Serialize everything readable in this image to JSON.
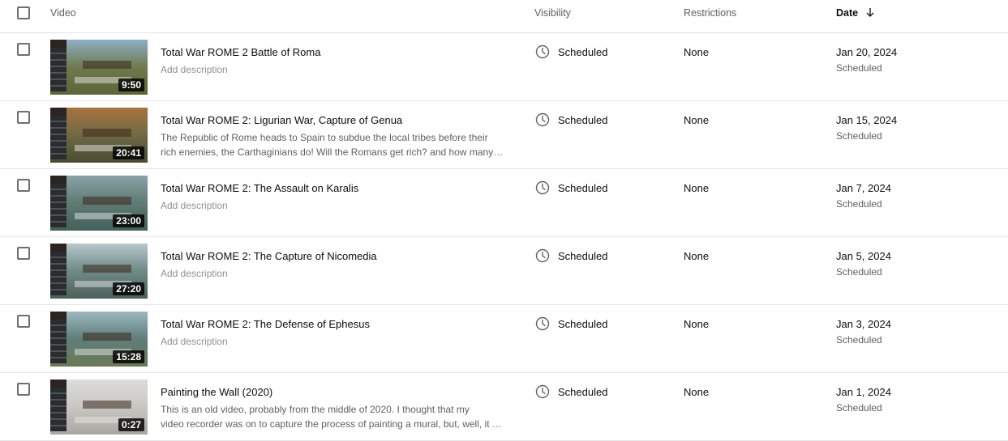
{
  "header": {
    "video": "Video",
    "visibility": "Visibility",
    "restrictions": "Restrictions",
    "date": "Date",
    "sort_icon": "arrow-down-icon"
  },
  "rows": [
    {
      "title": "Total War ROME 2 Battle of Roma",
      "desc_lines": [
        "Add description"
      ],
      "placeholder": true,
      "duration": "9:50",
      "visibility": "Scheduled",
      "restrictions": "None",
      "date": "Jan 20, 2024",
      "date_status": "Scheduled",
      "thumb_colors": [
        "#8fb0c4",
        "#6e7a4e",
        "#5a6638"
      ]
    },
    {
      "title": "Total War ROME 2: Ligurian War, Capture of Genua",
      "desc_lines": [
        "The Republic of Rome heads to Spain to subdue the local tribes before their",
        "rich enemies, the Carthaginians do! Will the Romans get rich? and how many dead?"
      ],
      "placeholder": false,
      "duration": "20:41",
      "visibility": "Scheduled",
      "restrictions": "None",
      "date": "Jan 15, 2024",
      "date_status": "Scheduled",
      "thumb_colors": [
        "#a8723f",
        "#6f6a45",
        "#4a4c32"
      ]
    },
    {
      "title": "Total War ROME 2: The Assault on Karalis",
      "desc_lines": [
        "Add description"
      ],
      "placeholder": true,
      "duration": "23:00",
      "visibility": "Scheduled",
      "restrictions": "None",
      "date": "Jan 7, 2024",
      "date_status": "Scheduled",
      "thumb_colors": [
        "#8aa3a7",
        "#5f7b74",
        "#44605a"
      ]
    },
    {
      "title": "Total War ROME 2: The Capture of Nicomedia",
      "desc_lines": [
        "Add description"
      ],
      "placeholder": true,
      "duration": "27:20",
      "visibility": "Scheduled",
      "restrictions": "None",
      "date": "Jan 5, 2024",
      "date_status": "Scheduled",
      "thumb_colors": [
        "#b7c6cc",
        "#6f8a86",
        "#4c5f5a"
      ]
    },
    {
      "title": "Total War ROME 2: The Defense of Ephesus",
      "desc_lines": [
        "Add description"
      ],
      "placeholder": true,
      "duration": "15:28",
      "visibility": "Scheduled",
      "restrictions": "None",
      "date": "Jan 3, 2024",
      "date_status": "Scheduled",
      "thumb_colors": [
        "#9bb8c0",
        "#5f7d7a",
        "#6b7a55"
      ]
    },
    {
      "title": "Painting the Wall (2020)",
      "desc_lines": [
        "This is an old video, probably from the middle of 2020. I thought that my",
        "video recorder was on to capture the process of painting a mural, but, well, it wasn't."
      ],
      "placeholder": false,
      "duration": "0:27",
      "visibility": "Scheduled",
      "restrictions": "None",
      "date": "Jan 1, 2024",
      "date_status": "Scheduled",
      "thumb_colors": [
        "#dcdcda",
        "#c9c7c2",
        "#a9a7a2"
      ]
    }
  ],
  "icons": {
    "checkbox": "checkbox-icon",
    "visibility": "clock-icon"
  }
}
